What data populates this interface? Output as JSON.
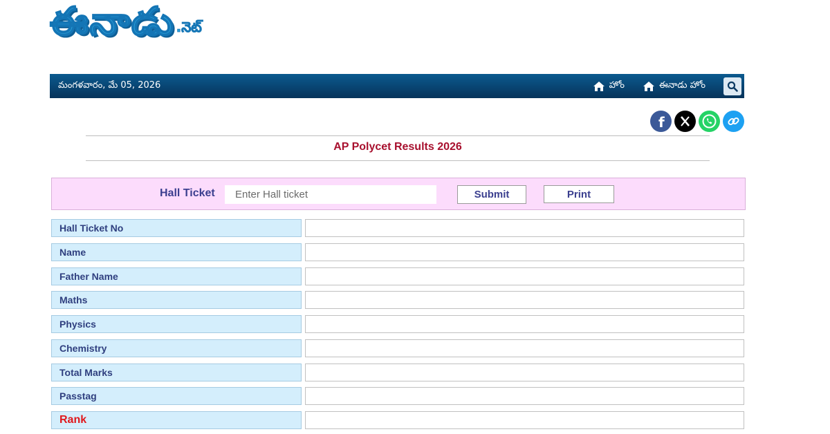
{
  "logo": {
    "main": "ఈనాడు",
    "suffix": ".నెట్"
  },
  "nav": {
    "date": "మంగళవారం, మే 05, 2026",
    "home": "హోం",
    "eenadu_home": "ఈనాడు హోం",
    "icons": [
      "home-icon",
      "home-icon",
      "search-icon"
    ]
  },
  "share": {
    "icons": [
      "facebook-icon",
      "x-icon",
      "whatsapp-icon",
      "link-icon"
    ]
  },
  "page": {
    "title": "AP Polycet Results 2026"
  },
  "form": {
    "label": "Hall Ticket",
    "placeholder": "Enter Hall ticket",
    "value": "",
    "submit": "Submit",
    "print": "Print"
  },
  "results": {
    "rows": [
      {
        "label": "Hall Ticket No",
        "value": ""
      },
      {
        "label": "Name",
        "value": ""
      },
      {
        "label": "Father Name",
        "value": ""
      },
      {
        "label": "Maths",
        "value": ""
      },
      {
        "label": "Physics",
        "value": ""
      },
      {
        "label": "Chemistry",
        "value": ""
      },
      {
        "label": "Total Marks",
        "value": ""
      },
      {
        "label": "Passtag",
        "value": ""
      },
      {
        "label": "Rank",
        "value": ""
      }
    ]
  },
  "colors": {
    "navbar": "#0b5a8f",
    "title": "#a8102e",
    "form_bg": "#fcdcfc",
    "label_bg": "#d4eefc",
    "rank_label": "#e0181c"
  }
}
